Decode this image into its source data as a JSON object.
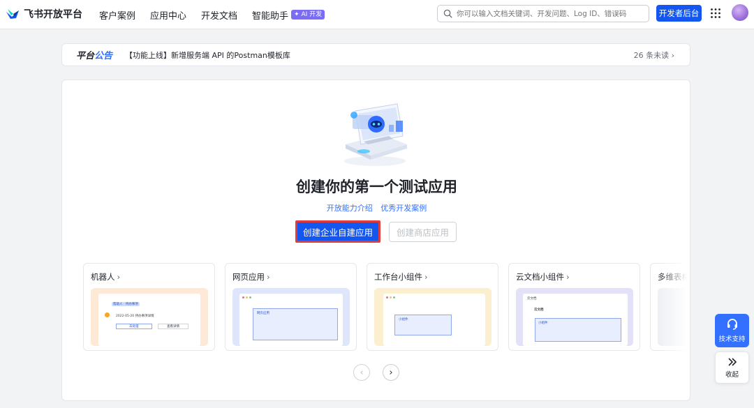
{
  "nav": {
    "logo_text": "飞书开放平台",
    "items": [
      "客户案例",
      "应用中心",
      "开发文档",
      "智能助手"
    ],
    "ai_badge": "✦ AI 开发",
    "search_placeholder": "你可以输入文档关键词、开发问题、Log ID、错误码",
    "dev_console": "开发者后台",
    "icons": {
      "search": "search-icon",
      "apps": "grid-icon"
    },
    "brand_color": "#1456f0"
  },
  "announcement": {
    "title_part1": "平台",
    "title_part2": "公告",
    "text": "【功能上线】新增服务端 API 的Postman模板库",
    "unread": "26 条未读 ›"
  },
  "hero": {
    "title": "创建你的第一个测试应用",
    "link1": "开放能力介绍",
    "link2": "优秀开发案例",
    "primary_button": "创建企业自建应用",
    "secondary_button": "创建商店应用"
  },
  "cards": [
    {
      "title": "机器人",
      "preview_text": [
        "帮助人 · 待办事项",
        "2022-05-20 待办事项详情",
        "去处理",
        "查看详情"
      ]
    },
    {
      "title": "网页应用",
      "preview_text": [
        "网页应用"
      ]
    },
    {
      "title": "工作台小组件",
      "preview_text": [
        "小组件"
      ]
    },
    {
      "title": "云文档小组件",
      "preview_text": [
        "云文档",
        "云文档",
        "小组件"
      ]
    },
    {
      "title": "多维表格"
    }
  ],
  "side": {
    "support_label": "技术支持",
    "collapse_label": "收起"
  }
}
